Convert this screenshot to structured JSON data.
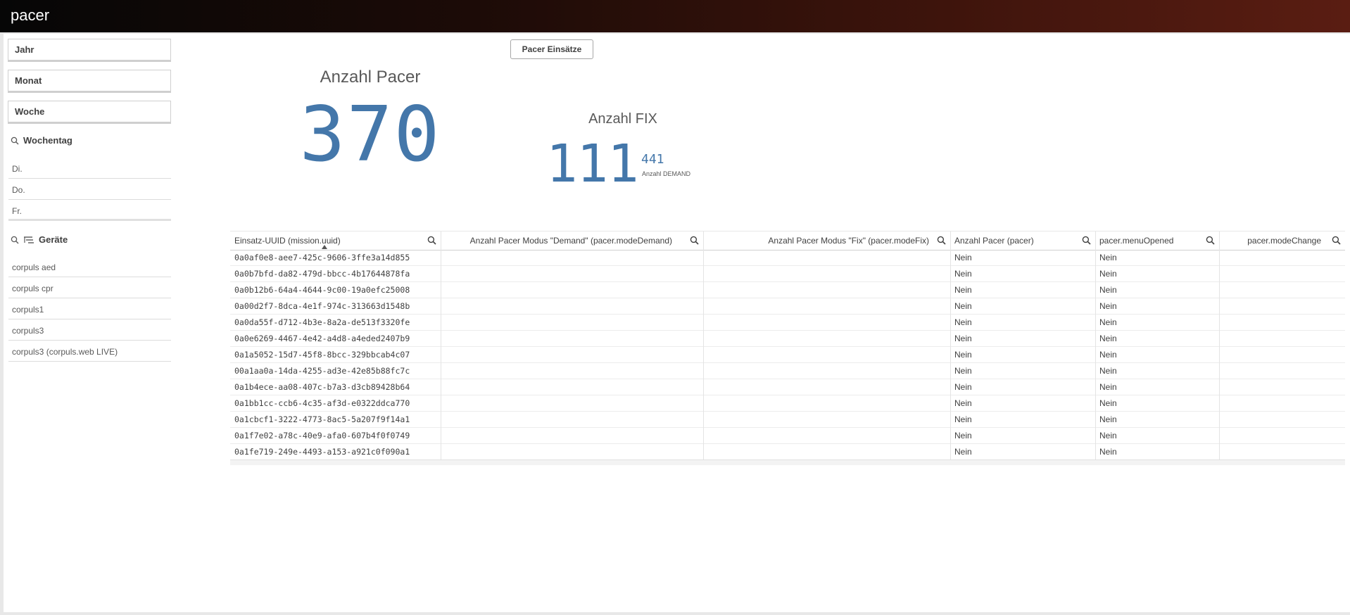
{
  "app": {
    "title": "pacer"
  },
  "filters": {
    "jahr": "Jahr",
    "monat": "Monat",
    "woche": "Woche"
  },
  "wochentag": {
    "title": "Wochentag",
    "items": [
      "Di.",
      "Do.",
      "Fr."
    ]
  },
  "geraete": {
    "title": "Geräte",
    "items": [
      "corpuls aed",
      "corpuls cpr",
      "corpuls1",
      "corpuls3",
      "corpuls3 (corpuls.web LIVE)"
    ]
  },
  "button": {
    "label": "Pacer Einsätze"
  },
  "kpi1": {
    "title": "Anzahl Pacer",
    "value": "370"
  },
  "kpi2": {
    "title": "Anzahl FIX",
    "value": "111",
    "sub_value": "441",
    "sub_label": "Anzahl DEMAND"
  },
  "table": {
    "columns": [
      "Einsatz-UUID (mission.uuid)",
      "Anzahl Pacer Modus \"Demand\" (pacer.modeDemand)",
      "Anzahl Pacer Modus \"Fix\" (pacer.modeFix)",
      "Anzahl Pacer (pacer)",
      "pacer.menuOpened",
      "pacer.modeChange"
    ],
    "rows": [
      [
        "0a0af0e8-aee7-425c-9606-3ffe3a14d855",
        "",
        "",
        "Nein",
        "Nein",
        ""
      ],
      [
        "0a0b7bfd-da82-479d-bbcc-4b17644878fa",
        "",
        "",
        "Nein",
        "Nein",
        ""
      ],
      [
        "0a0b12b6-64a4-4644-9c00-19a0efc25008",
        "",
        "",
        "Nein",
        "Nein",
        ""
      ],
      [
        "0a00d2f7-8dca-4e1f-974c-313663d1548b",
        "",
        "",
        "Nein",
        "Nein",
        ""
      ],
      [
        "0a0da55f-d712-4b3e-8a2a-de513f3320fe",
        "",
        "",
        "Nein",
        "Nein",
        ""
      ],
      [
        "0a0e6269-4467-4e42-a4d8-a4eded2407b9",
        "",
        "",
        "Nein",
        "Nein",
        ""
      ],
      [
        "0a1a5052-15d7-45f8-8bcc-329bbcab4c07",
        "",
        "",
        "Nein",
        "Nein",
        ""
      ],
      [
        "00a1aa0a-14da-4255-ad3e-42e85b88fc7c",
        "",
        "",
        "Nein",
        "Nein",
        ""
      ],
      [
        "0a1b4ece-aa08-407c-b7a3-d3cb89428b64",
        "",
        "",
        "Nein",
        "Nein",
        ""
      ],
      [
        "0a1bb1cc-ccb6-4c35-af3d-e0322ddca770",
        "",
        "",
        "Nein",
        "Nein",
        ""
      ],
      [
        "0a1cbcf1-3222-4773-8ac5-5a207f9f14a1",
        "",
        "",
        "Nein",
        "Nein",
        ""
      ],
      [
        "0a1f7e02-a78c-40e9-afa0-607b4f0f0749",
        "",
        "",
        "Nein",
        "Nein",
        ""
      ],
      [
        "0a1fe719-249e-4493-a153-a921c0f090a1",
        "",
        "",
        "Nein",
        "Nein",
        ""
      ]
    ]
  },
  "colors": {
    "accent": "#4477aa",
    "topbar_end": "#5a1d12"
  },
  "icons": [
    "search-icon",
    "sort-asc-icon",
    "drilldown-icon"
  ]
}
